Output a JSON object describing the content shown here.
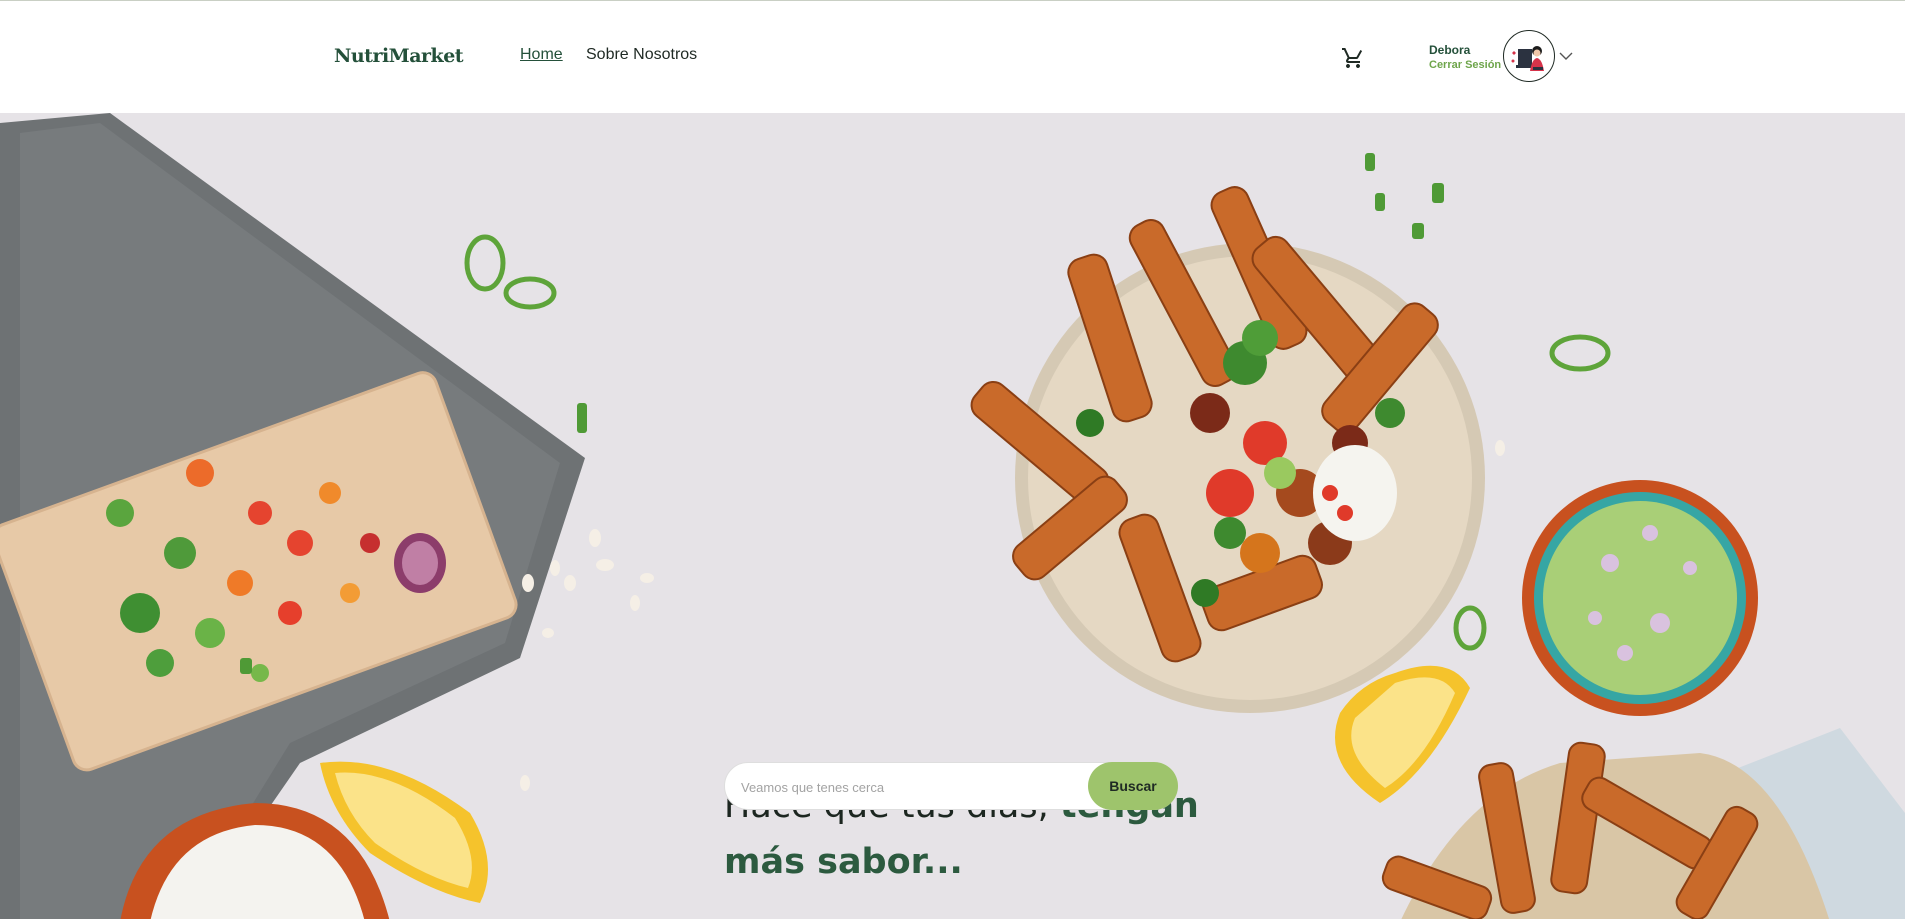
{
  "header": {
    "logo": "NutriMarket",
    "nav": [
      {
        "label": "Home",
        "active": true
      },
      {
        "label": "Sobre Nosotros",
        "active": false
      }
    ],
    "user": {
      "name": "Debora",
      "logout_label": "Cerrar Sesión"
    },
    "icons": {
      "cart": "cart-icon",
      "chevron": "chevron-down-icon",
      "avatar": "avatar"
    }
  },
  "hero": {
    "headline_regular": "Hace que tus días, ",
    "headline_bold": "tengan más sabor...",
    "search": {
      "placeholder": "Veamos que tenes cerca",
      "value": "",
      "button_label": "Buscar"
    }
  },
  "colors": {
    "brand_green": "#24503a",
    "accent_green": "#9ec46c",
    "logout_green": "#6ea54b",
    "hero_background": "#e6e3e7"
  }
}
